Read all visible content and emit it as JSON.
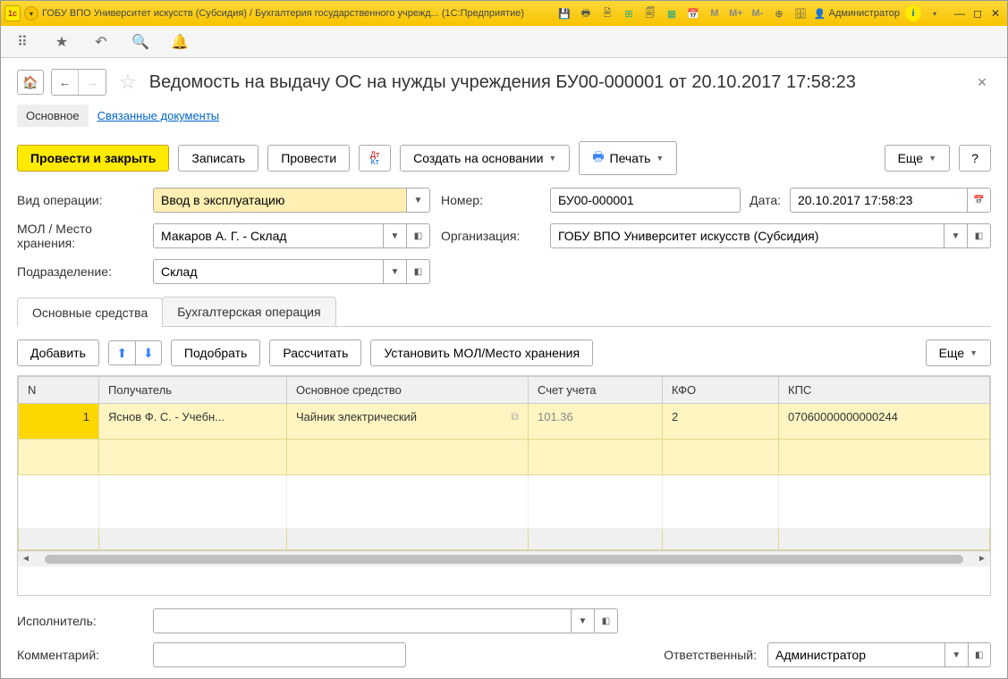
{
  "titlebar": {
    "title": "ГОБУ ВПО Университет искусств (Субсидия) / Бухгалтерия государственного учрежд... (1С:Предприятие)",
    "admin": "Администратор",
    "m": "M",
    "mplus": "M+",
    "mminus": "M-"
  },
  "header": {
    "page_title": "Ведомость на выдачу ОС на нужды учреждения БУ00-000001 от 20.10.2017 17:58:23"
  },
  "header_tabs": {
    "main": "Основное",
    "linked": "Связанные документы"
  },
  "actions": {
    "post_close": "Провести и закрыть",
    "save": "Записать",
    "post": "Провести",
    "create_based": "Создать на основании",
    "print": "Печать",
    "more": "Еще",
    "help": "?"
  },
  "fields": {
    "op_type_label": "Вид операции:",
    "op_type_value": "Ввод в эксплуатацию",
    "number_label": "Номер:",
    "number_value": "БУ00-000001",
    "date_label": "Дата:",
    "date_value": "20.10.2017 17:58:23",
    "mol_label": "МОЛ / Место хранения:",
    "mol_value": "Макаров А. Г. - Склад",
    "org_label": "Организация:",
    "org_value": "ГОБУ ВПО Университет искусств (Субсидия)",
    "dept_label": "Подразделение:",
    "dept_value": "Склад"
  },
  "tabs2": {
    "fixed_assets": "Основные средства",
    "accounting": "Бухгалтерская операция"
  },
  "table_actions": {
    "add": "Добавить",
    "pick": "Подобрать",
    "calc": "Рассчитать",
    "set_mol": "Установить МОЛ/Место хранения",
    "more": "Еще"
  },
  "table": {
    "headers": {
      "n": "N",
      "recipient": "Получатель",
      "asset": "Основное средство",
      "account": "Счет учета",
      "kfo": "КФО",
      "kps": "КПС"
    },
    "rows": [
      {
        "n": "1",
        "recipient": "Яснов Ф. С. - Учебн...",
        "asset": "Чайник электрический",
        "account": "101.36",
        "kfo": "2",
        "kps": "07060000000000244"
      }
    ]
  },
  "bottom": {
    "executor_label": "Исполнитель:",
    "executor_value": "",
    "comment_label": "Комментарий:",
    "comment_value": "",
    "responsible_label": "Ответственный:",
    "responsible_value": "Администратор"
  }
}
